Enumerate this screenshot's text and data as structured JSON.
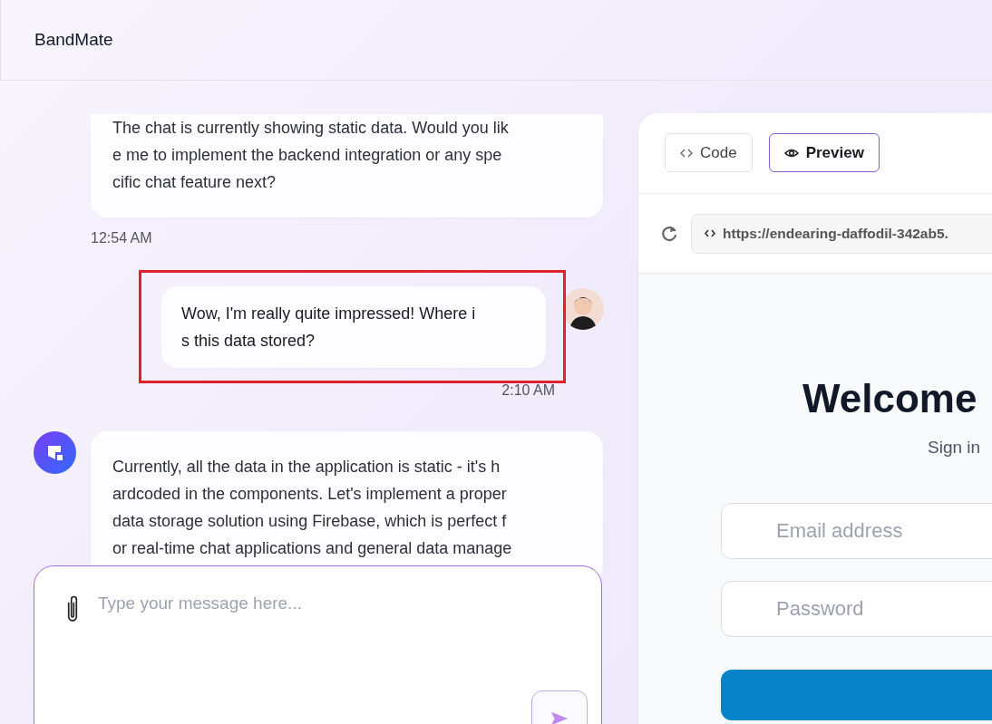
{
  "app": {
    "title": "BandMate"
  },
  "messages": [
    {
      "kind": "assistant",
      "avatar": false,
      "highlighted": false,
      "lines": [
        "The chat is currently showing static data. Would you lik",
        "e me to implement the backend integration or any spe",
        "cific chat feature next?"
      ],
      "time": "12:54 AM"
    },
    {
      "kind": "user",
      "avatar": true,
      "highlighted": true,
      "lines": [
        "Wow, I'm really quite impressed! Where i",
        "s this data stored?"
      ],
      "time": "2:10 AM"
    },
    {
      "kind": "assistant",
      "avatar": true,
      "highlighted": false,
      "lines": [
        "Currently, all the data in the application is static - it's h",
        "ardcoded in the components. Let's implement a proper",
        "data storage solution using Firebase, which is perfect f",
        "or real-time chat applications and general data manage"
      ]
    }
  ],
  "composer": {
    "placeholder": "Type your message here..."
  },
  "preview": {
    "tabs": [
      {
        "label": "Code",
        "selected": false
      },
      {
        "label": "Preview",
        "selected": true
      }
    ],
    "url": "https://endearing-daffodil-342ab5.",
    "site": {
      "heading": "Welcome",
      "subheading": "Sign in",
      "fields": [
        {
          "placeholder": "Email address"
        },
        {
          "placeholder": "Password"
        }
      ]
    }
  }
}
